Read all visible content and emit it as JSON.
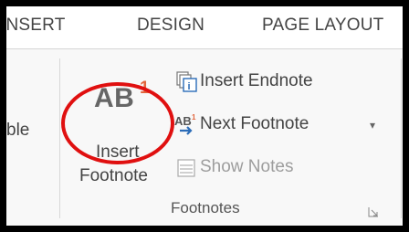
{
  "tabs": {
    "insert": "INSERT",
    "design": "DESIGN",
    "page_layout": "PAGE LAYOUT"
  },
  "ribbon": {
    "partial_left_label": "ble",
    "footnotes_group": {
      "label": "Footnotes",
      "insert_footnote": {
        "icon_text": "AB",
        "icon_superscript": "1",
        "label_line1": "Insert",
        "label_line2": "Footnote"
      },
      "insert_endnote": {
        "label": "Insert Endnote",
        "icon": "insert-endnote-icon"
      },
      "next_footnote": {
        "label": "Next Footnote",
        "icon": "next-footnote-icon",
        "dropdown": "▾"
      },
      "show_notes": {
        "label": "Show Notes",
        "icon": "show-notes-icon",
        "disabled": true
      }
    }
  },
  "colors": {
    "highlight_circle": "#e01010",
    "superscript": "#e2653d",
    "text": "#444444",
    "disabled_text": "#9d9d9d"
  }
}
